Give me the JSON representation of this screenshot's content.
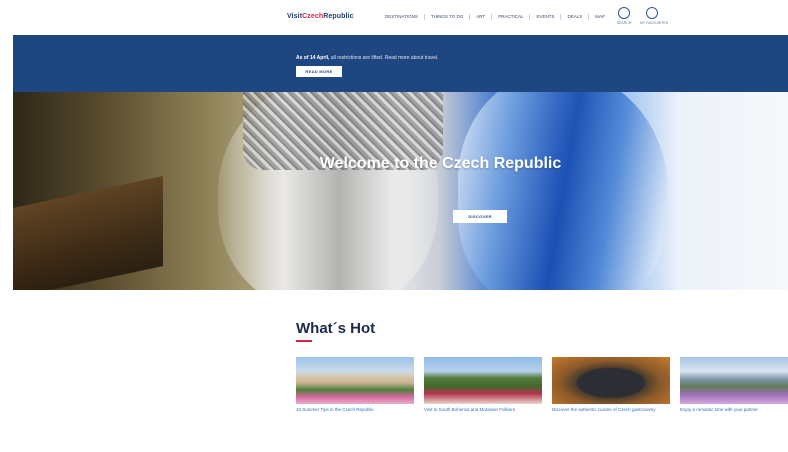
{
  "header": {
    "logo": {
      "part1": "Visit",
      "part2": "Czech",
      "part3": "Republic"
    },
    "nav_items": [
      "DESTINATIONS",
      "THINGS TO DO",
      "ART",
      "PRACTICAL",
      "EVENTS",
      "DEALS",
      "MAP"
    ],
    "icons": [
      {
        "name": "search-icon",
        "label": "SEARCH"
      },
      {
        "name": "user-icon",
        "label": "MY FAVOURITES"
      }
    ]
  },
  "banner": {
    "text_bold": "As of 14 April,",
    "text_rest": " all restrictions are lifted. Read more about travel.",
    "button": "READ MORE"
  },
  "hero": {
    "title": "Welcome to the Czech Republic",
    "button": "DISCOVER"
  },
  "whats_hot": {
    "title": "What´s Hot",
    "cards": [
      {
        "caption": "10 Summer Tips in the Czech Republic"
      },
      {
        "caption": "Visit to South Bohemia and Moravian Folklore"
      },
      {
        "caption": "Discover the authentic cuisine of Czech gastronomy"
      },
      {
        "caption": "Enjoy a romantic time with your partner"
      }
    ]
  },
  "colors": {
    "brand_blue": "#1e4680",
    "accent_red": "#d7263d"
  }
}
